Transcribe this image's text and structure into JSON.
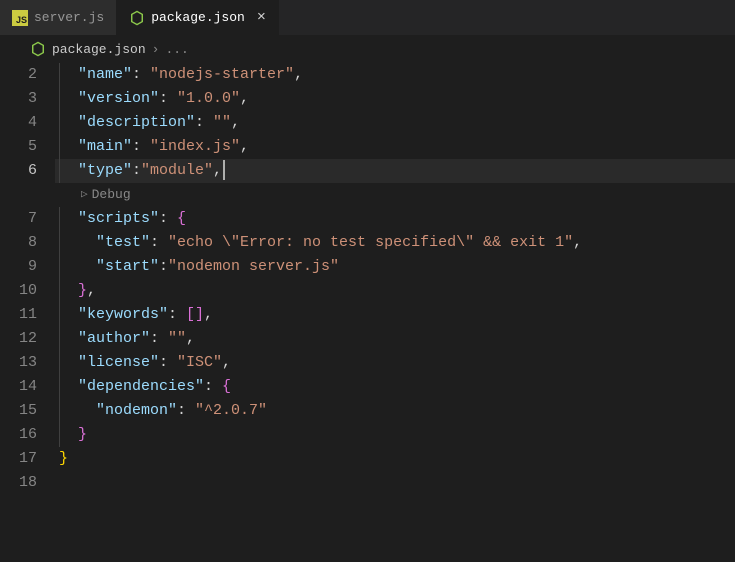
{
  "tabs": [
    {
      "label": "server.js",
      "icon": "js",
      "active": false,
      "close_visible": false
    },
    {
      "label": "package.json",
      "icon": "node",
      "active": true,
      "close_visible": true
    }
  ],
  "breadcrumb": {
    "file": "package.json",
    "icon": "node",
    "ellipsis": "..."
  },
  "currentLine": 6,
  "lineNumbers": [
    "2",
    "3",
    "4",
    "5",
    "6",
    "7",
    "8",
    "9",
    "10",
    "11",
    "12",
    "13",
    "14",
    "15",
    "16",
    "17",
    "18"
  ],
  "debug_label": "Debug",
  "code": {
    "l2": {
      "k": "\"name\"",
      "v": "\"nodejs-starter\""
    },
    "l3": {
      "k": "\"version\"",
      "v": "\"1.0.0\""
    },
    "l4": {
      "k": "\"description\"",
      "v": "\"\""
    },
    "l5": {
      "k": "\"main\"",
      "v": "\"index.js\""
    },
    "l6": {
      "k": "\"type\"",
      "v": "\"module\""
    },
    "l7": {
      "k": "\"scripts\""
    },
    "l8": {
      "k": "\"test\"",
      "v": "\"echo \\\"Error: no test specified\\\" && exit 1\""
    },
    "l9": {
      "k": "\"start\"",
      "v": "\"nodemon server.js\""
    },
    "l11": {
      "k": "\"keywords\""
    },
    "l12": {
      "k": "\"author\"",
      "v": "\"\""
    },
    "l13": {
      "k": "\"license\"",
      "v": "\"ISC\""
    },
    "l14": {
      "k": "\"dependencies\""
    },
    "l15": {
      "k": "\"nodemon\"",
      "v": "\"^2.0.7\""
    }
  }
}
